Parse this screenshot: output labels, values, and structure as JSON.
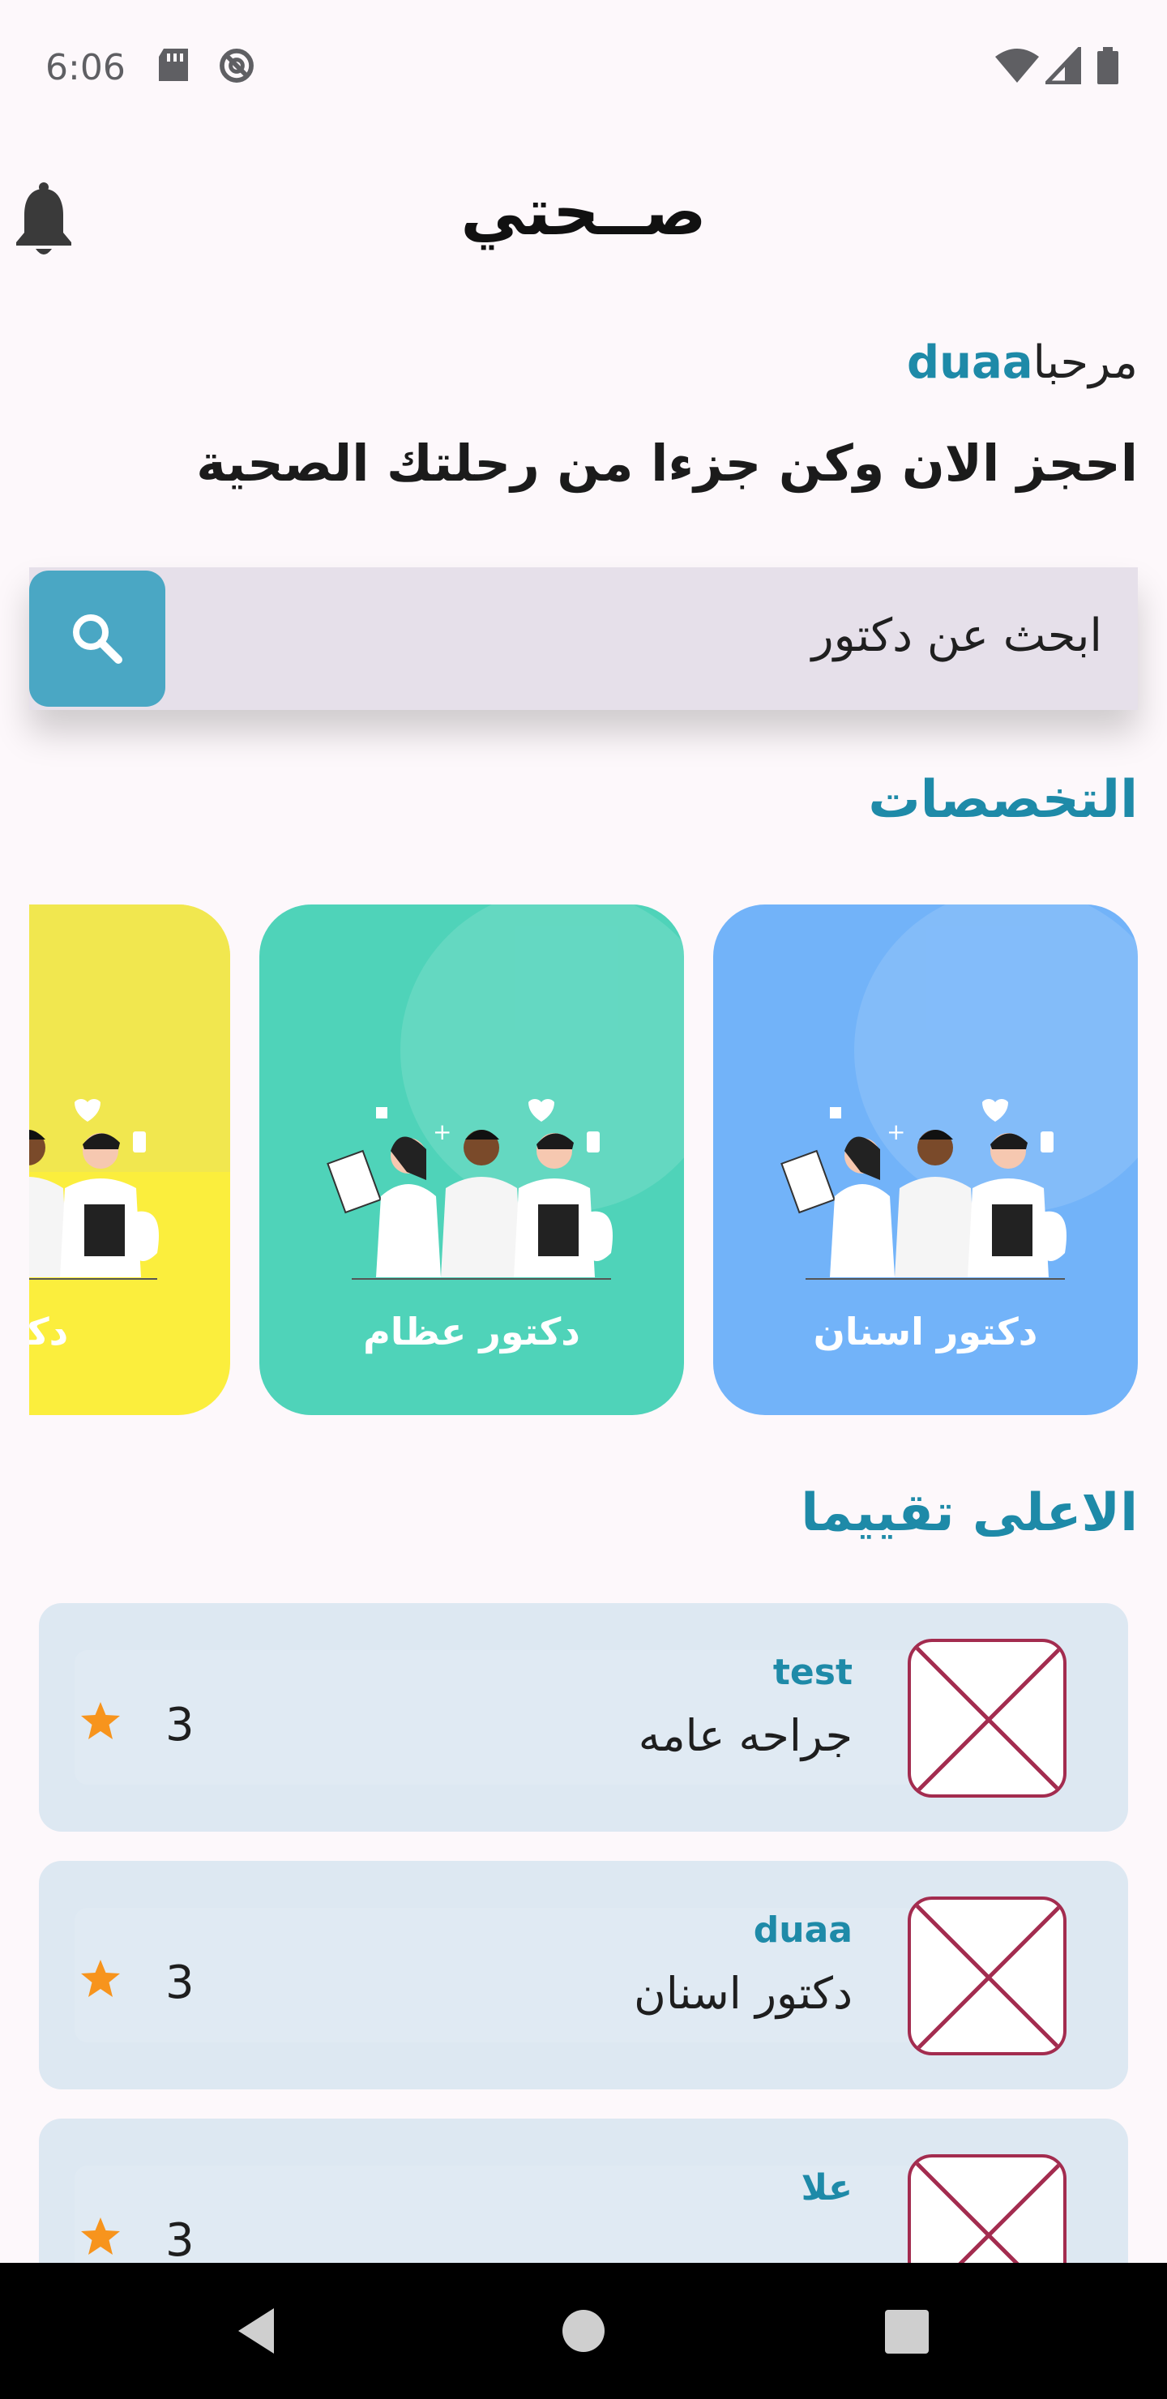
{
  "status_bar": {
    "time": "6:06"
  },
  "app_bar": {
    "title": "صــحتي"
  },
  "greeting": {
    "prefix": "مرحبا",
    "username": "duaa"
  },
  "subtitle": "احجز الان وكن جزءا من رحلتك الصحية",
  "search": {
    "placeholder": "ابحث عن دكتور"
  },
  "specialties": {
    "title": "التخصصات",
    "items": [
      {
        "label": "دكتور اسنان",
        "color": "#72b3f9"
      },
      {
        "label": "دكتور عظام",
        "color": "#4fd3b9"
      },
      {
        "label": "دكتور",
        "color": "#fbee3d"
      }
    ]
  },
  "top_rated": {
    "title": "الاعلى تقييما",
    "doctors": [
      {
        "name": "test",
        "specialty": "جراحه عامه",
        "rating": "3"
      },
      {
        "name": "duaa",
        "specialty": "دكتور اسنان",
        "rating": "3"
      },
      {
        "name": "علا",
        "specialty": "",
        "rating": "3"
      }
    ]
  },
  "colors": {
    "accent": "#1e8aa8",
    "search_button": "#4aa7c4",
    "star": "#f7941d"
  }
}
